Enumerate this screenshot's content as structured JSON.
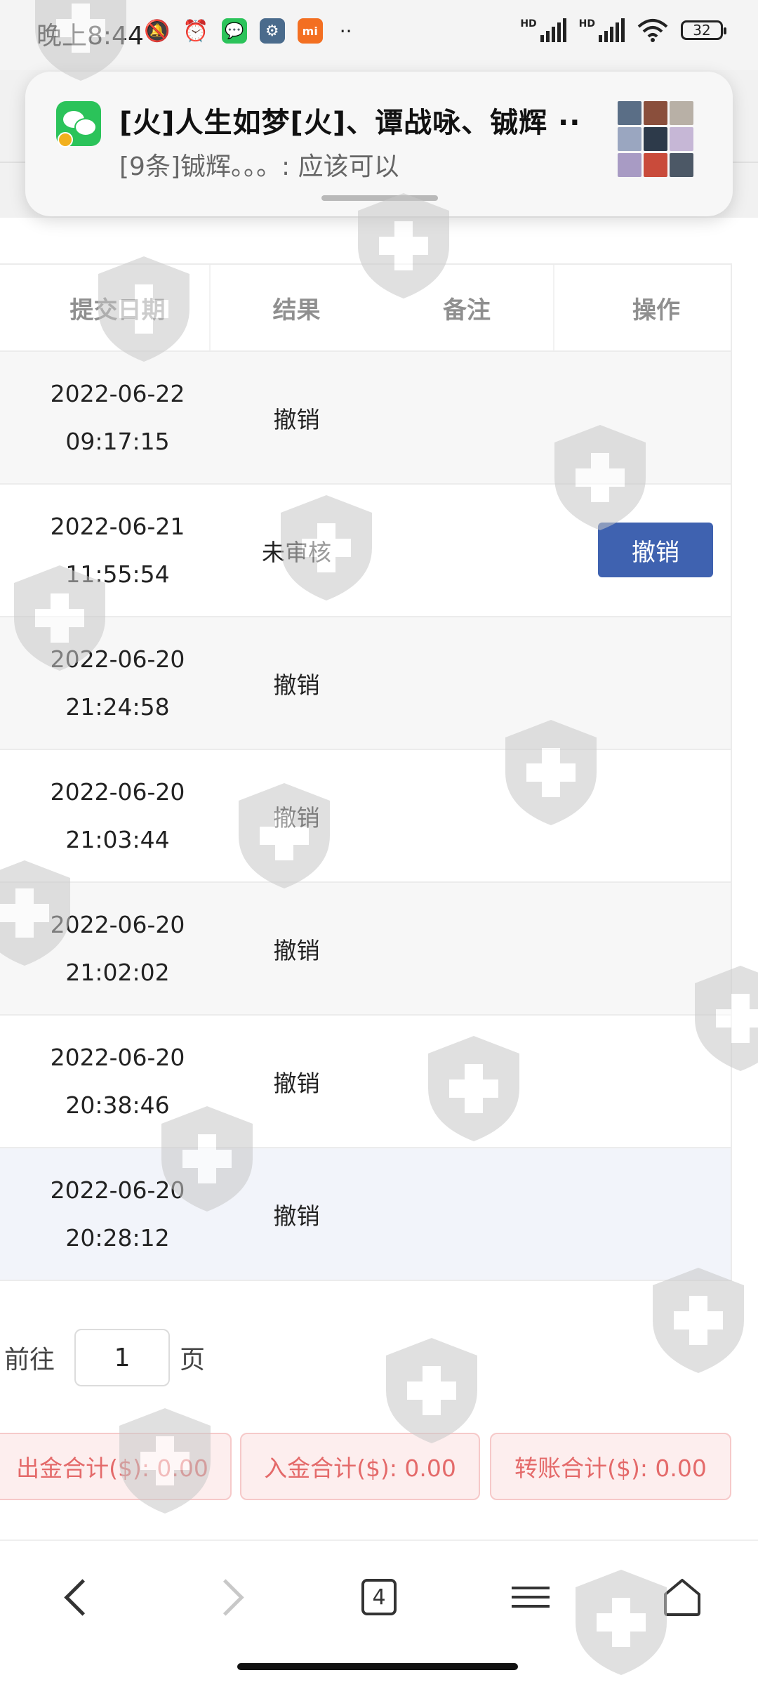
{
  "status_bar": {
    "time": "晚上8:44",
    "battery": "32",
    "hd_label": "HD",
    "more_dots": "··"
  },
  "notification": {
    "title": "[火]人生如梦[火]、谭战咏、铖辉 ··",
    "text": "[9条]铖辉。。。: 应该可以"
  },
  "table": {
    "headers": [
      "提交日期",
      "结果",
      "备注",
      "操作"
    ],
    "rows": [
      {
        "date": "2022-06-22",
        "time": "09:17:15",
        "result": "撤销",
        "action": ""
      },
      {
        "date": "2022-06-21",
        "time": "11:55:54",
        "result": "未审核",
        "action": "撤销"
      },
      {
        "date": "2022-06-20",
        "time": "21:24:58",
        "result": "撤销",
        "action": ""
      },
      {
        "date": "2022-06-20",
        "time": "21:03:44",
        "result": "撤销",
        "action": ""
      },
      {
        "date": "2022-06-20",
        "time": "21:02:02",
        "result": "撤销",
        "action": ""
      },
      {
        "date": "2022-06-20",
        "time": "20:38:46",
        "result": "撤销",
        "action": ""
      },
      {
        "date": "2022-06-20",
        "time": "20:28:12",
        "result": "撤销",
        "action": ""
      }
    ]
  },
  "pagination": {
    "prefix": "前往",
    "page_value": "1",
    "suffix": "页"
  },
  "totals": {
    "withdraw": "出金合计($): 0.00",
    "deposit": "入金合计($): 0.00",
    "transfer": "转账合计($): 0.00"
  },
  "browser_nav": {
    "tab_count": "4"
  },
  "colors": {
    "primary_button": "#3f62b0",
    "totals_text": "#e46a6a",
    "totals_bg": "#fdeeee",
    "wechat_green": "#2bc35a"
  }
}
